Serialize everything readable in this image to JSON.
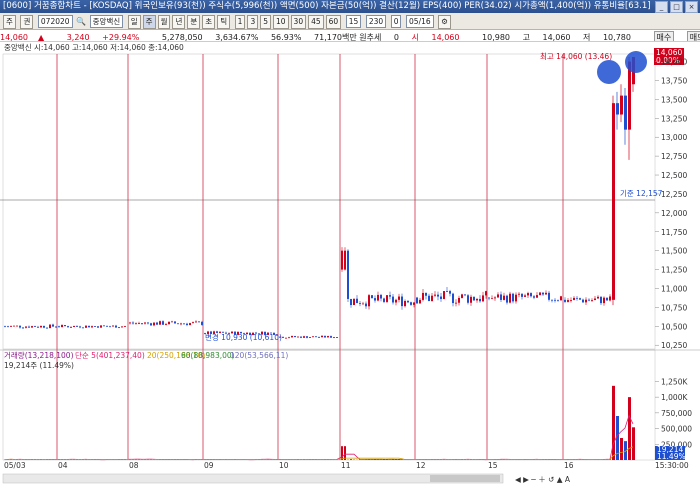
{
  "window": {
    "title": "[0600] 거꿈종합차트 - [KOSDAQ] 위국인보유(93(천)) 주식수(5,996(천)) 액면(500) 자본금(50(억)) 결산(12월) EPS(400) PER(34.02) 시가총액(1,400(억)) 유통비율[63.1]",
    "buttons": [
      "_",
      "□",
      "×"
    ]
  },
  "toolbar": {
    "mode": "주",
    "period": "권",
    "code": "072020",
    "name": "중앙백신",
    "buttons": [
      "일",
      "주",
      "월",
      "년",
      "분",
      "초",
      "틱"
    ],
    "tick_buttons": [
      "1",
      "3",
      "5",
      "10",
      "30",
      "45",
      "60"
    ],
    "unit": "15",
    "count": "230",
    "sub": "0",
    "date": "05/16"
  },
  "pricebar": {
    "price": "14,060",
    "arrow": "▲",
    "change": "3,240",
    "change_pct": "+29.94%",
    "volume": "5,278,050",
    "amount": "3,634.67%",
    "shares": "56.93%",
    "value": "71,170백만 원추세",
    "zero": "0",
    "open": "14,060",
    "high_label": "시",
    "high": "10,980",
    "high_label2": "고",
    "low": "14,060",
    "low_label": "저",
    "last": "10,780",
    "buy": "매수",
    "sell": "매도"
  },
  "price_panel": {
    "legend": "중앙백신 시:14,060 고:14,060 저:14,060 종:14,060",
    "high_note": "최고 14,060 (13.46)",
    "last_price_tag": "14,060",
    "last_pct_tag": "0.00%",
    "marker_label": "기준 12,157",
    "event_label": "변경 10,930 (10,610)",
    "y_ticks": [
      "14,000",
      "13,750",
      "13,500",
      "13,250",
      "13,000",
      "12,750",
      "12,500",
      "12,250",
      "12,000",
      "11,750",
      "11,500",
      "11,250",
      "11,000",
      "10,750",
      "10,500",
      "10,250"
    ]
  },
  "volume_panel": {
    "legend_main": "거래량(13,218,100)",
    "legend_ma": "단순 5(401,237,40)",
    "legend_ma2": "20(250,198,10)",
    "legend_ma3": "60(88,983,00)",
    "legend_ma4": "120(53,566,11)",
    "legend_sub": "19,214주 (11.49%)",
    "y_ticks": [
      "1,250K",
      "1,000K",
      "750,000",
      "500,000",
      "250,000"
    ],
    "last_tag": "19,214",
    "last_tag2": "11.49%"
  },
  "x_axis": {
    "labels": [
      "05/03",
      "04",
      "08",
      "09",
      "10",
      "11",
      "12",
      "15",
      "16"
    ],
    "time_label": "15:30:00"
  },
  "colors": {
    "up": "#d3001b",
    "down": "#1f4fd1",
    "grid_v": "#c8102e",
    "ma5": "#e0206f",
    "ma20": "#d6a000",
    "ma60": "#2f8f2f",
    "ma120": "#7070c0",
    "highlight_circle": "#1f4fd1"
  },
  "chart_data": {
    "type": "candlestick",
    "sessions": [
      "05/03",
      "04",
      "08",
      "09",
      "10",
      "11",
      "12",
      "15",
      "16"
    ],
    "price_ylim": [
      10200,
      14100
    ],
    "volume_ylim": [
      0,
      1400000
    ],
    "segments": [
      {
        "session": "05/03",
        "level": 10500,
        "volatility": 25
      },
      {
        "session": "04",
        "level": 10500,
        "volatility": 20
      },
      {
        "session": "08",
        "level": 10540,
        "volatility": 30
      },
      {
        "session": "09",
        "level": 10410,
        "volatility": 25
      },
      {
        "session": "10",
        "level": 10360,
        "volatility": 15
      },
      {
        "session": "11",
        "level": 10840,
        "volatility": 80
      },
      {
        "session": "12",
        "level": 10880,
        "volatility": 90
      },
      {
        "session": "15",
        "level": 10880,
        "volatility": 70
      },
      {
        "session": "16",
        "level": 10850,
        "volatility": 60
      }
    ],
    "spike": {
      "open": 10850,
      "close": 14060,
      "high": 14060,
      "low": 10780
    },
    "annotated_high": 14060,
    "reference_level": 12157
  }
}
